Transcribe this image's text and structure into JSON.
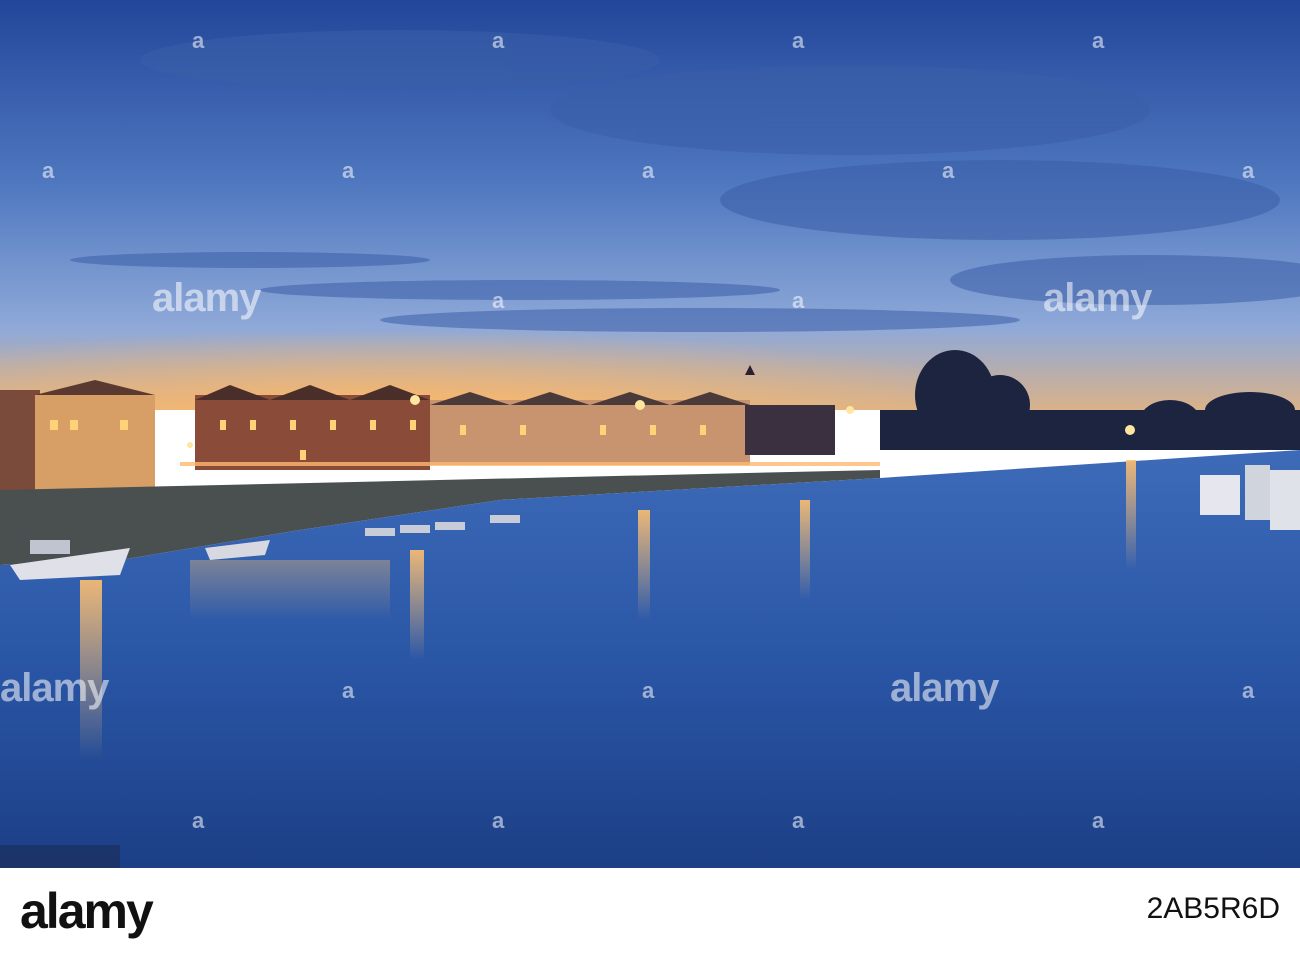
{
  "photo": {
    "description_colors": {
      "sky_top": "#2d4fa0",
      "sky_mid": "#5f86c8",
      "horizon_glow": "#f0a85a",
      "water": "#2a56a6",
      "lights": "#ffb347"
    }
  },
  "watermark": {
    "text": "alamy",
    "icon": "a"
  },
  "footer": {
    "logo": "alamy",
    "image_id": "2AB5R6D"
  }
}
